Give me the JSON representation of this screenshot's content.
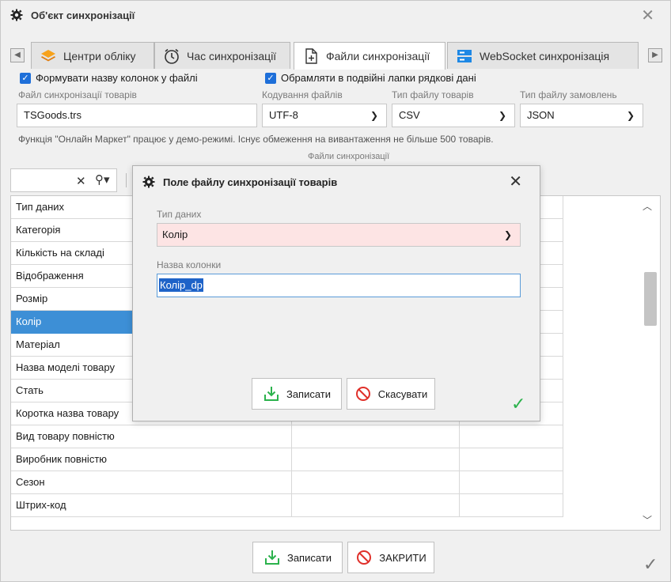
{
  "window": {
    "title": "Об'єкт синхронізації"
  },
  "tabs": [
    {
      "label": "Центри обліку"
    },
    {
      "label": "Час синхронізації"
    },
    {
      "label": "Файли синхронізації"
    },
    {
      "label": "WebSocket синхронізація"
    }
  ],
  "options": {
    "generate_column_names": "Формувати назву колонок у файлі",
    "quote_strings": "Обрамляти в подвійні лапки рядкові дані"
  },
  "fields": {
    "sync_file_label": "Файл синхронізації товарів",
    "sync_file_value": "TSGoods.trs",
    "encoding_label": "Кодування файлів",
    "encoding_value": "UTF-8",
    "goods_type_label": "Тип файлу товарів",
    "goods_type_value": "CSV",
    "orders_type_label": "Тип файлу замовлень",
    "orders_type_value": "JSON"
  },
  "notice": "Функція \"Онлайн Маркет\" працює у демо-режимі. Існує обмеження на вивантаження не більше 500 товарів.",
  "section_label": "Файли синхронізації",
  "table": {
    "rows": [
      "Тип даних",
      "Категорія",
      "Кількість на складі",
      "Відображення",
      "Розмір",
      "Колір",
      "Матеріал",
      "Назва моделі товару",
      "Стать",
      "Коротка назва товару",
      "Вид товару повністю",
      "Виробник повністю",
      "Сезон",
      "Штрих-код"
    ]
  },
  "footer": {
    "save_label": "Записати",
    "close_label": "ЗАКРИТИ"
  },
  "modal": {
    "title": "Поле файлу синхронізації товарів",
    "type_label": "Тип даних",
    "type_value": "Колір",
    "name_label": "Назва колонки",
    "name_value": "Колір_dp",
    "save_label": "Записати",
    "cancel_label": "Скасувати"
  },
  "colors": {
    "accent": "#1e6fd9",
    "selection": "#3d8fd6",
    "invalid_field": "#fde4e4",
    "ok_green": "#2bb24c"
  }
}
